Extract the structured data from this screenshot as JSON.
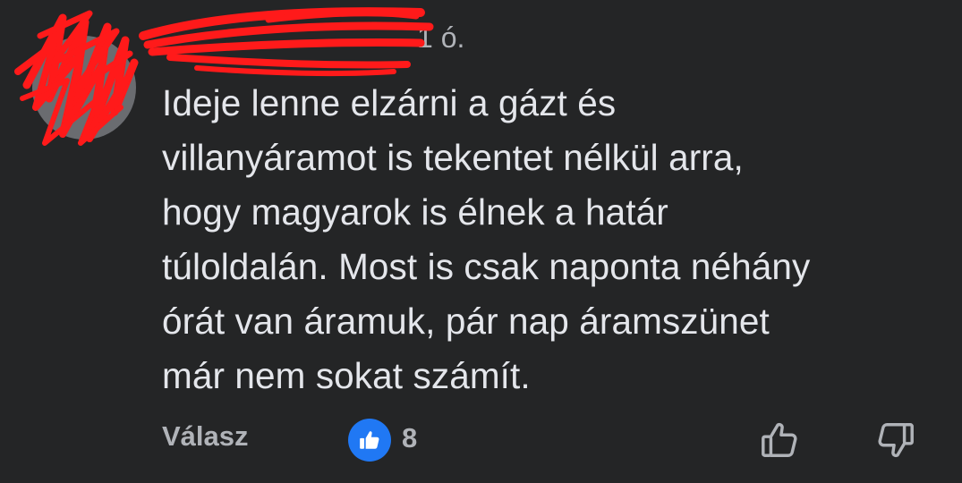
{
  "comment": {
    "author": "",
    "timestamp": "1 ó.",
    "body_lines": [
      "Ideje lenne elzárni a gázt és",
      "villanyáramot is tekentet nélkül arra,",
      "hogy magyarok is élnek a határ",
      "túloldalán. Most is csak naponta néhány",
      "órát van áramuk, pár nap áramszünet",
      "már nem sokat számít."
    ]
  },
  "actions": {
    "reply_label": "Válasz",
    "reaction_count": "8",
    "reaction_icon": "like-icon",
    "upvote_icon": "thumbs-up-outline-icon",
    "downvote_icon": "thumbs-down-outline-icon"
  },
  "colors": {
    "background": "#242526",
    "primary_text": "#e4e6eb",
    "secondary_text": "#b0b3b8",
    "like_blue": "#2078f4",
    "redaction_red": "#ff1a1a"
  }
}
